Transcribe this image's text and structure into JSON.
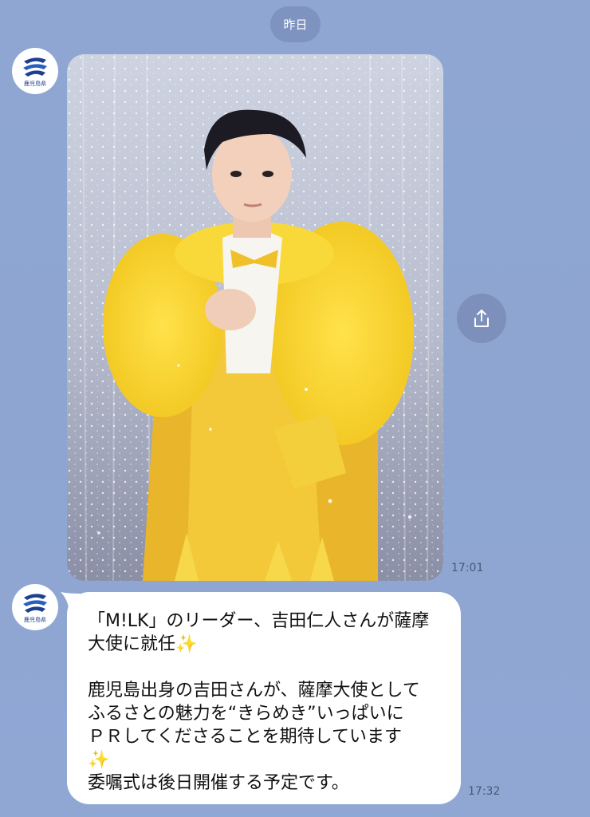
{
  "chat": {
    "date_separator": "昨日",
    "sender": {
      "avatar_label": "鹿児島県"
    },
    "messages": [
      {
        "type": "image",
        "time": "17:01"
      },
      {
        "type": "text",
        "time": "17:32",
        "lines": [
          "「M!LK」のリーダー、吉田仁人さんが薩摩",
          "大使に就任",
          "鹿児島出身の吉田さんが、薩摩大使として",
          "ふるさとの魅力を“きらめき”いっぱいに",
          "ＰＲしてくださることを期待しています",
          "委嘱式は後日開催する予定です。"
        ],
        "emoji": "✨"
      }
    ]
  },
  "icons": {
    "share": "share-icon",
    "sparkles": "sparkles-emoji"
  },
  "colors": {
    "background": "#8fa6d3",
    "bubble": "#ffffff",
    "pill": "#7f93c0"
  }
}
